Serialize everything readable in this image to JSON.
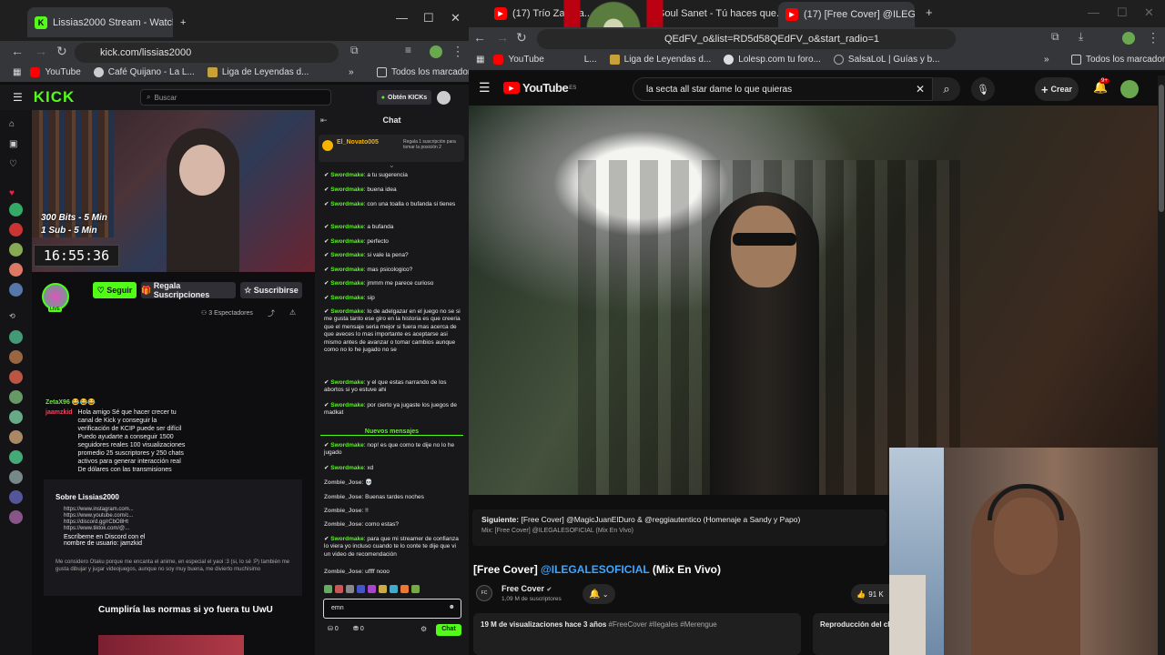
{
  "left_browser": {
    "tab_title": "Lissias2000 Stream - Watch",
    "url": "kick.com/lissias2000",
    "bookmarks": [
      "YouTube",
      "Café Quijano - La L...",
      "Liga de Leyendas d..."
    ],
    "all_bookmarks": "Todos los marcadores"
  },
  "kick": {
    "search_placeholder": "Buscar",
    "get_kicks": "Obtén KICKs",
    "chat_title": "Chat",
    "stream_overlay_1": "300 Bits - 5 Min",
    "stream_overlay_2": "1 Sub - 5 Min",
    "stream_clock": "16:55:36",
    "follow": "Seguir",
    "gift_subs": "Regala Suscripciones",
    "subscribe": "Suscribirse",
    "viewers": "3 Espectadores",
    "pinned_user": "El_Novato005",
    "pinned_text": "Regala 1 suscripción para tomar la posición 2",
    "new_messages": "Nuevos mensajes",
    "chat_input": "emn",
    "chat_button": "Chat",
    "points_1": "0",
    "points_2": "0",
    "about_title": "Sobre Lissias2000",
    "bottom_text": "Cumpliría las normas si yo fuera tu UwU",
    "messages": [
      {
        "user": "Swordmake",
        "text": "a tu sugerencia"
      },
      {
        "user": "Swordmake",
        "text": "buena idea"
      },
      {
        "user": "Swordmake",
        "text": "con una toalla o bufanda si tienes"
      },
      {
        "user": "Swordmake",
        "text": "a bufanda"
      },
      {
        "user": "Swordmake",
        "text": "perfecto"
      },
      {
        "user": "Swordmake",
        "text": "si vale la pena?"
      },
      {
        "user": "Swordmake",
        "text": "mas psicologico?"
      },
      {
        "user": "Swordmake",
        "text": "jmmm me parece curioso"
      },
      {
        "user": "Swordmake",
        "text": "sip"
      },
      {
        "user": "Swordmake",
        "text": "lo de adelgazar en el juego no se si me gusta tanto ese giro en la historia es que creeria que el mensaje seria mejor si fuera mas acerca de que aveces lo mas importante es aceptarse asi mismo antes de avanzar o tomar cambios aunque como no lo he jugado no se"
      },
      {
        "user": "Swordmake",
        "text": "y el que estas narrando de los abortos si yo estuve ahi"
      },
      {
        "user": "Swordmake",
        "text": "por cierto ya jugaste los juegos de madkat"
      }
    ],
    "messages_new": [
      {
        "user": "Swordmake",
        "text": "nop! es que como te dije no lo he jugado"
      },
      {
        "user": "Swordmake",
        "text": "xd"
      },
      {
        "user": "Zombie_Jose",
        "text": "💀"
      },
      {
        "user": "Zombie_Jose",
        "text": "Buenas tardes noches"
      },
      {
        "user": "Zombie_Jose",
        "text": "!!"
      },
      {
        "user": "Zombie_Jose",
        "text": "como estas?"
      },
      {
        "user": "Swordmake",
        "text": "para que mi streamer de confianza lo viera yo incluso cuando te lo conte te dije que vi un video de recomendación"
      },
      {
        "user": "Zombie_Jose",
        "text": "uffff nooo"
      }
    ],
    "overlay_chat": [
      {
        "user": "ZetaX96",
        "text": "😂😂😂"
      },
      {
        "user": "jaamzkid",
        "text": "Hola amigo Sé que hacer crecer tu canal de Kick y conseguir la verificación de KCIP puede ser difícil Puedo ayudarte a conseguir 1500 seguidores reales 100 visualizaciones promedio 25 suscriptores y 250 chats activos para generar interacción real De dólares con las transmisiones"
      }
    ],
    "overlay_links": [
      "https://www.instagram.com...",
      "https://www.youtube.com/c...",
      "https://discord.gg/rCbO8Ht",
      "https://www.tiktok.com/@..."
    ],
    "overlay_about": "Escríbeme en Discord con el nombre de usuario: jamzkid",
    "overlay_footer": "Me considero Otaku porque me encanta el anime, en especial el yaoi :3 (si, lo sé :P) también me gusta dibujar y jugar videojuegos, aunque no soy muy buena, me divierto muchísimo"
  },
  "right_browser": {
    "tabs": [
      "(17) Trío Zapata...",
      "Soul Sanet - Tú haces que...",
      "(17) [Free Cover] @ILEGALE..."
    ],
    "url": "QEdFV_o&list=RD5d58QEdFV_o&start_radio=1",
    "bookmarks": [
      "YouTube",
      "L...",
      "Liga de Leyendas d...",
      "Lolesp.com tu foro...",
      "SalsaLoL | Guías y b..."
    ],
    "all_bookmarks": "Todos los marcadores"
  },
  "youtube": {
    "logo": "YouTube",
    "region": "ES",
    "search": "la secta all star dame lo que quieras",
    "create": "Crear",
    "notif_count": "9+",
    "next_label": "Siguiente:",
    "next_title": "[Free Cover] @MagicJuanElDuro & @reggiautentico (Homenaje a Sandy y Papo)",
    "next_sub": "Mix: [Free Cover] @ILEGALESOFICIAL (Mix En Vivo)",
    "title_pre": "[Free Cover]",
    "title_link": "@ILEGALESOFICIAL",
    "title_post": "(Mix En Vivo)",
    "channel": "Free Cover",
    "subs": "1,09 M de suscriptores",
    "likes": "91 K",
    "views": "19 M de visualizaciones",
    "age": "hace 3 años",
    "tags": "#FreeCover #Ilegales #Merengue",
    "playlist": "Reproducción del ch"
  },
  "colors": {
    "kick_green": "#53fc18",
    "yt_red": "#ff0000",
    "link_blue": "#3ea6ff"
  }
}
